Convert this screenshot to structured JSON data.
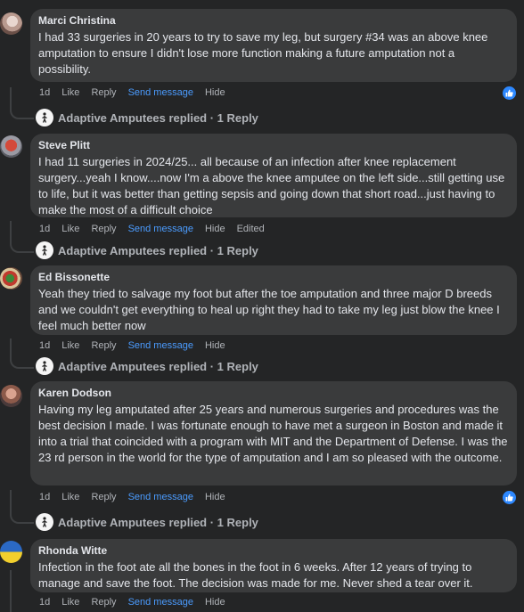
{
  "comments": [
    {
      "author": "Marci Christina",
      "text": "I had 33 surgeries in 20 years to try to save my leg, but surgery #34 was an above knee amputation to ensure I didn't lose more function making a future amputation not a possibility.",
      "time": "1d",
      "like": "Like",
      "reply": "Reply",
      "send": "Send message",
      "hide": "Hide",
      "replies": "Adaptive Amputees replied · 1 Reply"
    },
    {
      "author": "Steve Plitt",
      "text": "I had 11 surgeries in 2024/25... all because of an infection after knee replacement surgery...yeah I know....now I'm a above the knee amputee on the left side...still getting use to life, but it was better than getting sepsis and going down that short road...just having to make the most of a difficult choice",
      "time": "1d",
      "like": "Like",
      "reply": "Reply",
      "send": "Send message",
      "hide": "Hide",
      "edited": "Edited",
      "replies": "Adaptive Amputees replied · 1 Reply"
    },
    {
      "author": "Ed Bissonette",
      "text": "Yeah they tried to salvage my foot but after the toe amputation and three major D breeds and we couldn't get everything to heal up right they had to take my leg just blow the knee I feel much better now",
      "time": "1d",
      "like": "Like",
      "reply": "Reply",
      "send": "Send message",
      "hide": "Hide",
      "replies": "Adaptive Amputees replied · 1 Reply"
    },
    {
      "author": "Karen Dodson",
      "text": "Having my leg amputated after 25 years and numerous surgeries and procedures was the best decision I made. I was fortunate enough to have met a surgeon in Boston and made it into a trial that coincided with a program with MIT and the Department of Defense. I was the 23 rd person in the world for the type of amputation and I am so pleased with the outcome.",
      "time": "1d",
      "like": "Like",
      "reply": "Reply",
      "send": "Send message",
      "hide": "Hide",
      "replies": "Adaptive Amputees replied · 1 Reply"
    },
    {
      "author": "Rhonda Witte",
      "text": "Infection in the foot ate all the bones in the foot in 6 weeks. After 12 years of trying to manage and save the foot. The decision was made for me. Never shed a tear over it.",
      "time": "1d",
      "like": "Like",
      "reply": "Reply",
      "send": "Send message",
      "hide": "Hide"
    }
  ],
  "colors": {
    "background": "#242526",
    "bubble": "#3a3b3c",
    "link": "#4b9cff",
    "like_badge": "#2d88ff"
  }
}
